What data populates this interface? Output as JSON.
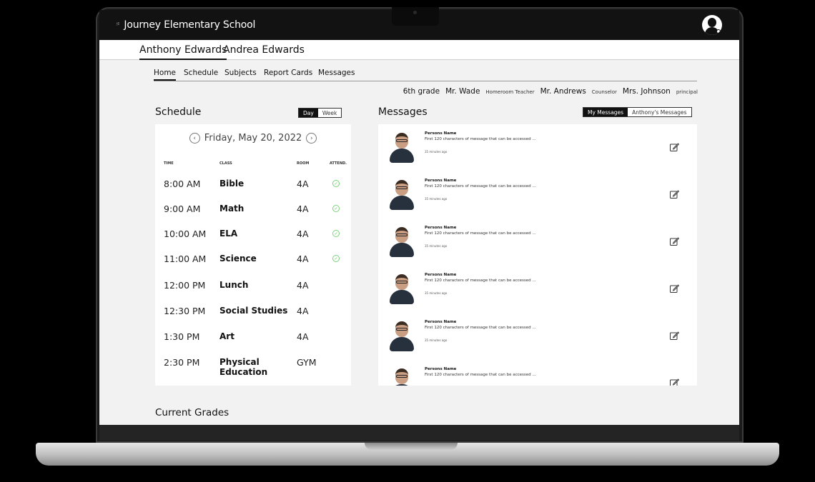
{
  "app": {
    "school_name": "Journey Elementary School"
  },
  "students": [
    {
      "label": "Anthony Edwards",
      "active": true
    },
    {
      "label": "Andrea Edwards",
      "active": false
    }
  ],
  "nav_tabs": [
    {
      "label": "Home",
      "active": true
    },
    {
      "label": "Schedule",
      "active": false
    },
    {
      "label": "Subjects",
      "active": false
    },
    {
      "label": "Report Cards",
      "active": false
    },
    {
      "label": "Messages",
      "active": false
    }
  ],
  "staff": {
    "grade": "6th grade",
    "homeroom_name": "Mr. Wade",
    "homeroom_role": "Homeroom Teacher",
    "counselor_name": "Mr. Andrews",
    "counselor_role": "Counselor",
    "principal_name": "Mrs. Johnson",
    "principal_role": "principal"
  },
  "schedule": {
    "title": "Schedule",
    "toggle_day": "Day",
    "toggle_week": "Week",
    "selected_view": "Day",
    "date": "Friday, May 20, 2022",
    "headers": {
      "time": "TIME",
      "class": "CLASS",
      "room": "ROOM",
      "attend": "ATTEND."
    },
    "rows": [
      {
        "time": "8:00 AM",
        "class": "Bible",
        "room": "4A",
        "attended": true
      },
      {
        "time": "9:00 AM",
        "class": "Math",
        "room": "4A",
        "attended": true
      },
      {
        "time": "10:00 AM",
        "class": "ELA",
        "room": "4A",
        "attended": true
      },
      {
        "time": "11:00 AM",
        "class": "Science",
        "room": "4A",
        "attended": true
      },
      {
        "time": "12:00 PM",
        "class": "Lunch",
        "room": "4A",
        "attended": false
      },
      {
        "time": "12:30 PM",
        "class": "Social Studies",
        "room": "4A",
        "attended": false
      },
      {
        "time": "1:30 PM",
        "class": "Art",
        "room": "4A",
        "attended": false
      },
      {
        "time": "2:30 PM",
        "class": "Physical Education",
        "room": "GYM",
        "attended": false
      }
    ]
  },
  "messages": {
    "title": "Messages",
    "toggle_mine": "My Messages",
    "toggle_child": "Anthony's Messages",
    "selected_view": "My Messages",
    "items": [
      {
        "name": "Persons Name",
        "preview": "First 120 characters of message that can be accessed ...",
        "time_ago": "35 minutes ago"
      },
      {
        "name": "Persons Name",
        "preview": "First 120 characters of message that can be accessed ...",
        "time_ago": "35 minutes ago"
      },
      {
        "name": "Persons Name",
        "preview": "First 120 characters of message that can be accessed ...",
        "time_ago": "35 minutes ago"
      },
      {
        "name": "Persons Name",
        "preview": "First 120 characters of message that can be accessed ...",
        "time_ago": "35 minutes ago"
      },
      {
        "name": "Persons Name",
        "preview": "First 120 characters of message that can be accessed ...",
        "time_ago": "35 minutes ago"
      },
      {
        "name": "Persons Name",
        "preview": "First 120 characters of message that can be accessed ...",
        "time_ago": ""
      }
    ]
  },
  "grades": {
    "title": "Current Grades"
  },
  "colors": {
    "topbar": "#121212",
    "screen_bg": "#f2f2f2",
    "attend_check": "#5bbf5b"
  },
  "icons": {
    "logo": "spark-icon",
    "user": "user-avatar-icon",
    "prev": "chevron-left-icon",
    "next": "chevron-right-icon",
    "attend": "check-circle-icon",
    "edit": "edit-icon"
  }
}
